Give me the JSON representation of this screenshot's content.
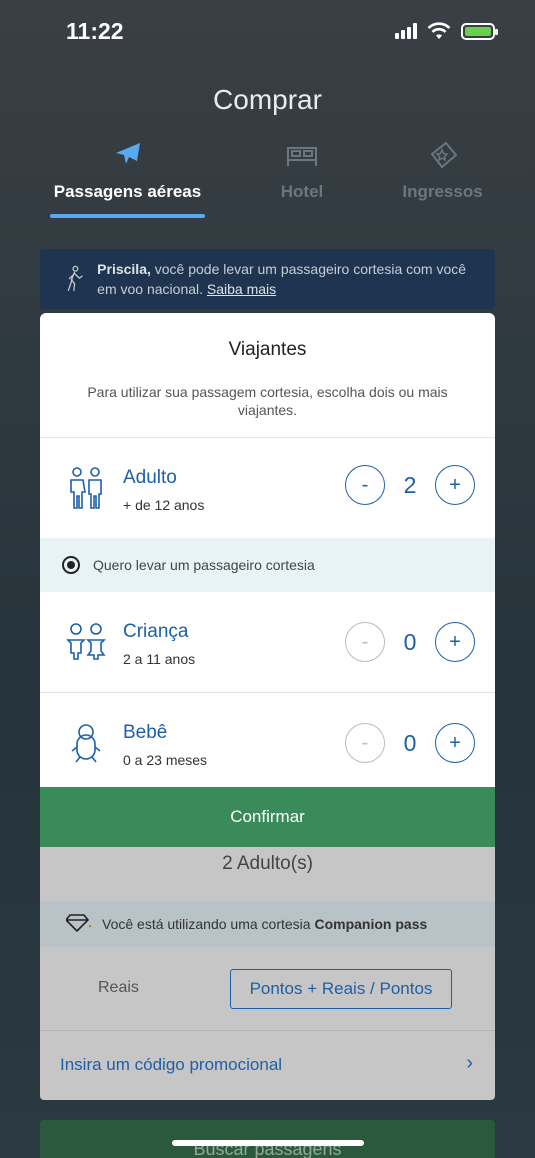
{
  "status": {
    "time": "11:22"
  },
  "page_title": "Comprar",
  "tabs": [
    {
      "label": "Passagens aéreas",
      "icon": "airplane-icon",
      "active": true
    },
    {
      "label": "Hotel",
      "icon": "bed-icon",
      "active": false
    },
    {
      "label": "Ingressos",
      "icon": "ticket-icon",
      "active": false
    }
  ],
  "banner": {
    "name": "Priscila,",
    "text": " você pode levar um passageiro cortesia com você em voo nacional. ",
    "link": "Saiba mais"
  },
  "modal": {
    "title": "Viajantes",
    "subtitle": "Para utilizar sua passagem cortesia, escolha dois ou mais viajantes.",
    "rows": [
      {
        "title": "Adulto",
        "sub": "+ de 12 anos",
        "value": "2",
        "minus": "-",
        "plus": "+",
        "icon": "adults-icon"
      },
      {
        "title": "Criança",
        "sub": "2 a 11 anos",
        "value": "0",
        "minus": "-",
        "plus": "+",
        "icon": "children-icon"
      },
      {
        "title": "Bebê",
        "sub": "0 a 23 meses",
        "value": "0",
        "minus": "-",
        "plus": "+",
        "icon": "baby-icon"
      }
    ],
    "courtesy_option": "Quero levar um passageiro cortesia",
    "confirm_label": "Confirmar"
  },
  "lower": {
    "summary": "2 Adulto(s)",
    "companion_text": "Você está utilizando uma cortesia ",
    "companion_bold": "Companion pass",
    "pay_reais": "Reais",
    "pay_points": "Pontos + Reais / Pontos",
    "promo": "Insira um código promocional",
    "promo_chevron": "›"
  },
  "search_button": "Buscar passagens",
  "colors": {
    "accent": "#1e5fa8",
    "confirm": "#3b8a5a",
    "tab_active": "#5aa9f0"
  }
}
